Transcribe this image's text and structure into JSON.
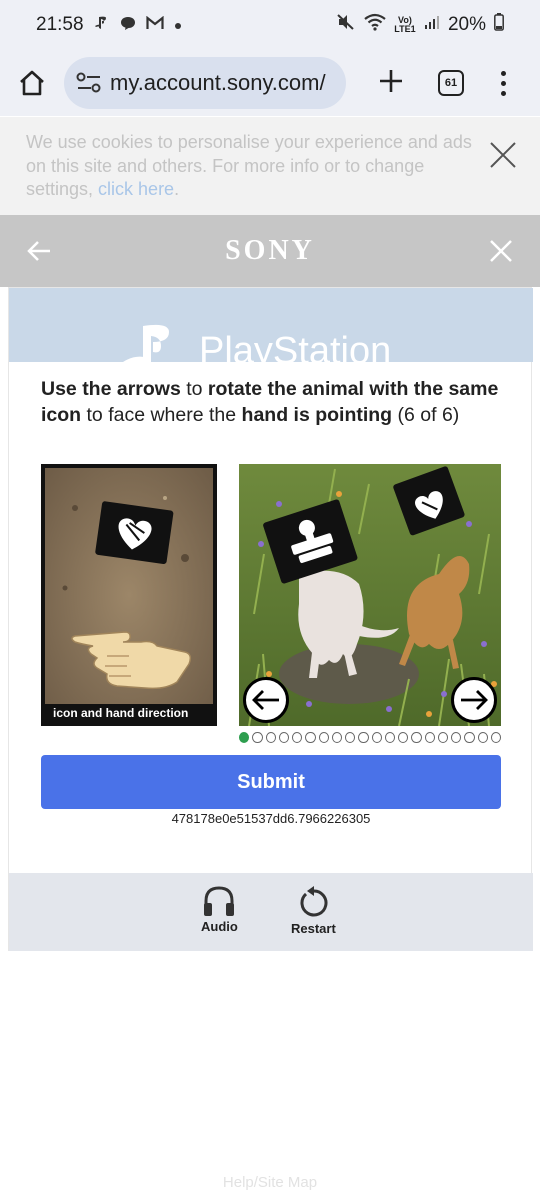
{
  "status_bar": {
    "time": "21:58",
    "battery": "20%",
    "left_icons": [
      "playstation-icon",
      "chat-icon",
      "gmail-icon",
      "dot-icon"
    ],
    "right_icons": [
      "mute-icon",
      "wifi-icon",
      "volte-icon",
      "signal-icon",
      "battery-icon"
    ],
    "volte_label": "Vo) LTE1"
  },
  "browser": {
    "url": "my.account.sony.com/",
    "tab_count": "61"
  },
  "cookie_banner": {
    "text": "We use cookies to personalise your experience and ads on this site and others. For more info or to change settings, ",
    "link_text": "click here",
    "text_end": "."
  },
  "header": {
    "logo": "SONY"
  },
  "captcha": {
    "banner_text": "PlayStation",
    "instruction_parts": {
      "p1": "Use the arrows",
      "p2": " to ",
      "p3": "rotate the animal with the same icon",
      "p4": " to face where the ",
      "p5": "hand is pointing",
      "p6": " (6 of 6)"
    },
    "hint_caption": "icon and hand direction",
    "dot_count": 20,
    "active_dot": 0,
    "submit_label": "Submit",
    "session_id": "478178e0e51537dd6.7966226305",
    "audio_label": "Audio",
    "restart_label": "Restart"
  },
  "footer": {
    "link": "Help/Site Map"
  },
  "colors": {
    "submit": "#4a72e8",
    "active_dot": "#2e9e4f",
    "sony_bar": "#c6c6c6",
    "banner": "#c9d8e8"
  }
}
